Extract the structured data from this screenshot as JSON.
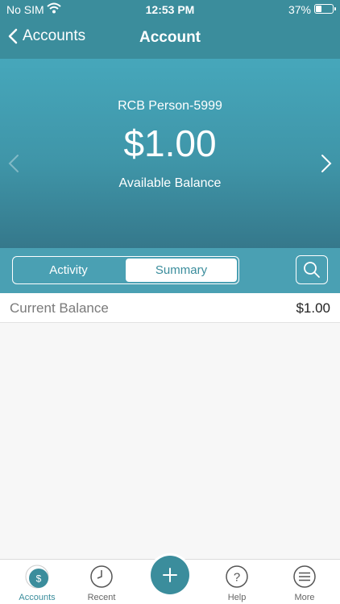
{
  "status_bar": {
    "carrier": "No SIM",
    "time": "12:53 PM",
    "battery": "37%"
  },
  "nav": {
    "back_label": "Accounts",
    "title": "Account"
  },
  "hero": {
    "account_name": "RCB Person-5999",
    "amount": "$1.00",
    "balance_label": "Available Balance"
  },
  "segments": {
    "activity": "Activity",
    "summary": "Summary",
    "selected": "Summary"
  },
  "summary": {
    "label": "Current Balance",
    "value": "$1.00"
  },
  "tabbar": {
    "accounts": "Accounts",
    "recent": "Recent",
    "help": "Help",
    "more": "More",
    "selected": "Accounts"
  },
  "colors": {
    "accent": "#3b8d9c",
    "hero_top": "#46a7bb",
    "hero_bottom": "#35788b",
    "segment_bar": "#4aa0b3"
  }
}
